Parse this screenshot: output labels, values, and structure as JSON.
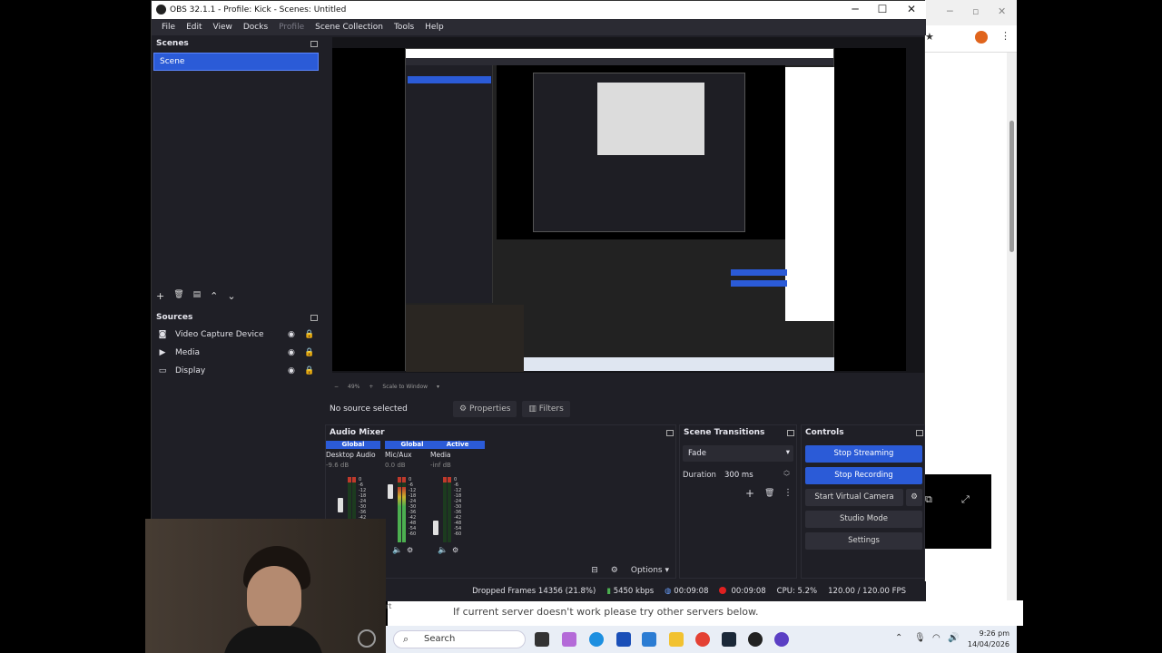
{
  "window": {
    "title": "OBS 32.1.1 - Profile: Kick - Scenes: Untitled",
    "minimize": "─",
    "maximize": "☐",
    "close": "✕"
  },
  "menu": [
    "File",
    "Edit",
    "View",
    "Docks",
    "Profile",
    "Scene Collection",
    "Tools",
    "Help"
  ],
  "scenes": {
    "title": "Scenes",
    "items": [
      "Scene"
    ],
    "toolbar": [
      "+",
      "🗑",
      "▤",
      "⌃",
      "⌄"
    ]
  },
  "sources": {
    "title": "Sources",
    "items": [
      {
        "label": "Video Capture Device",
        "icon": "camera-icon"
      },
      {
        "label": "Media",
        "icon": "play-icon"
      },
      {
        "label": "Display",
        "icon": "monitor-icon"
      }
    ]
  },
  "preview": {
    "zoom": "49%",
    "scale_mode": "Scale to Window"
  },
  "source_bar": {
    "no_source": "No source selected",
    "properties": "Properties",
    "filters": "Filters"
  },
  "audio_mixer": {
    "title": "Audio Mixer",
    "channels": [
      {
        "header": "Global",
        "name": "Desktop Audio",
        "db": "-9.6 dB",
        "header_color": "#2b5bd7",
        "level": 0.35
      },
      {
        "header": "Global",
        "name": "Mic/Aux",
        "db": "0.0 dB",
        "header_color": "#2b5bd7",
        "level": 0.85
      },
      {
        "header": "Active",
        "name": "Media",
        "db": "-inf dB",
        "header_color": "#2b5bd7",
        "level": 0.0
      }
    ],
    "scale": [
      "0",
      "-6",
      "-12",
      "-18",
      "-24",
      "-30",
      "-36",
      "-42",
      "-48",
      "-54",
      "-60"
    ],
    "options": "Options"
  },
  "transitions": {
    "title": "Scene Transitions",
    "selected": "Fade",
    "duration_label": "Duration",
    "duration_value": "300 ms"
  },
  "controls": {
    "title": "Controls",
    "stop_streaming": "Stop Streaming",
    "stop_recording": "Stop Recording",
    "virtual_camera": "Start Virtual Camera",
    "studio_mode": "Studio Mode",
    "settings": "Settings"
  },
  "status": {
    "dropped_frames": "Dropped Frames 14356 (21.8%)",
    "bitrate": "5450 kbps",
    "stream_time": "00:09:08",
    "record_time": "00:09:08",
    "cpu": "CPU: 5.2%",
    "fps": "120.00 / 120.00 FPS"
  },
  "background": {
    "helper_text": "If current server doesn't work please try other servers below.",
    "snippet": "rt"
  },
  "taskbar": {
    "search": "Search",
    "time": "9:26 pm",
    "date": "14/04/2026"
  },
  "colors": {
    "accent": "#2b5bd7",
    "panel": "#1f1f26",
    "record": "#e02020",
    "meter_green": "#4caf50",
    "meter_red": "#c0392b"
  }
}
